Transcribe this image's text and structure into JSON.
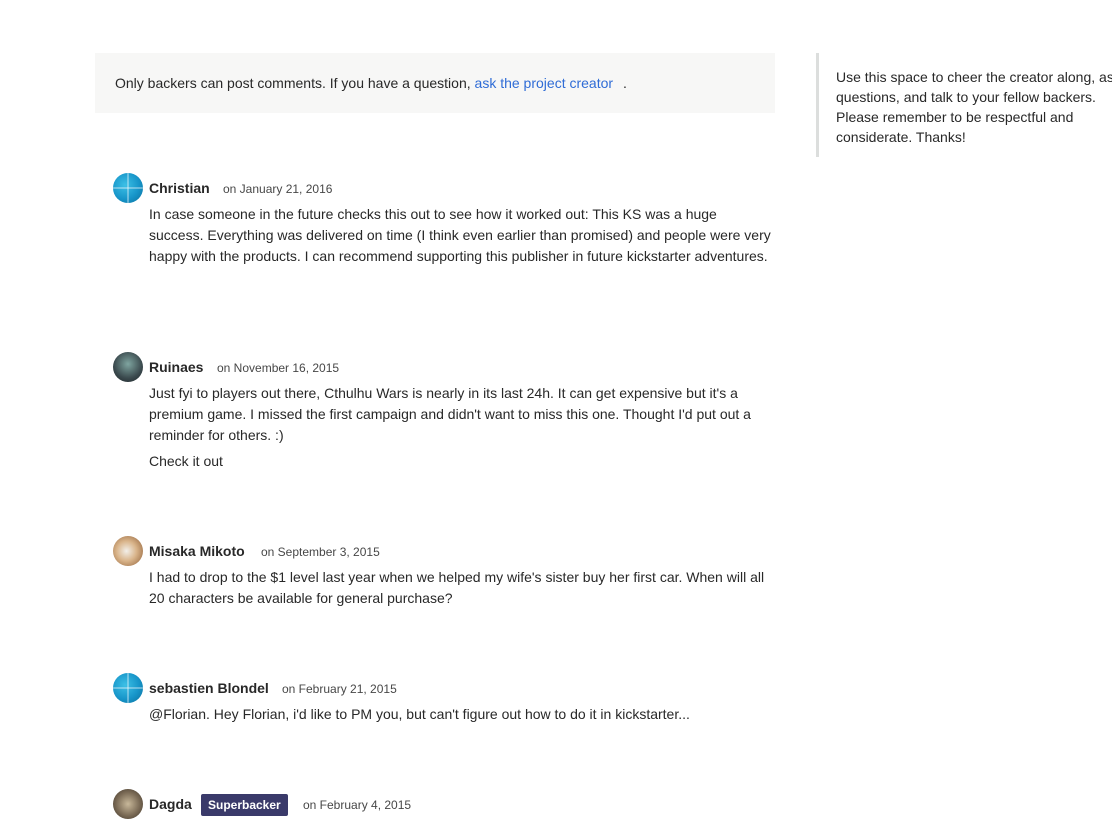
{
  "notice": {
    "text": "Only backers can post comments. If you have a question,",
    "link": "ask the project creator",
    "period": "."
  },
  "sidebar": {
    "text": "Use this space to cheer the creator along, as\nquestions, and talk to your fellow backers.\nPlease remember to be respectful and\nconsiderate. Thanks!"
  },
  "comments": [
    {
      "author": "Christian",
      "date": "on January 21, 2016",
      "paragraphs": [
        "In case someone in the future checks this out to see how it worked out: This KS was a huge success. Everything was delivered on time (I think even earlier than promised) and people were very happy with the products. I can recommend supporting this publisher in future kickstarter adventures."
      ]
    },
    {
      "author": "Ruinaes",
      "date": "on November 16, 2015",
      "paragraphs": [
        "Just fyi to players out there, Cthulhu Wars is nearly in its last 24h. It can get expensive but it's a premium game. I missed the first campaign and didn't want to miss this one. Thought I'd put out a reminder for others. :)",
        "Check it out"
      ]
    },
    {
      "author": "Misaka Mikoto",
      "date": "on September 3, 2015",
      "paragraphs": [
        "I had to drop to the $1 level last year when we helped my wife's sister buy her first car. When will all 20 characters be available for general purchase?"
      ]
    },
    {
      "author": "sebastien Blondel",
      "date": "on February 21, 2015",
      "paragraphs": [
        "@Florian. Hey Florian, i'd like to PM you, but can't figure out how to do it in kickstarter..."
      ]
    },
    {
      "author": "Dagda",
      "badge": "Superbacker",
      "date": "on February 4, 2015",
      "paragraphs": []
    }
  ]
}
